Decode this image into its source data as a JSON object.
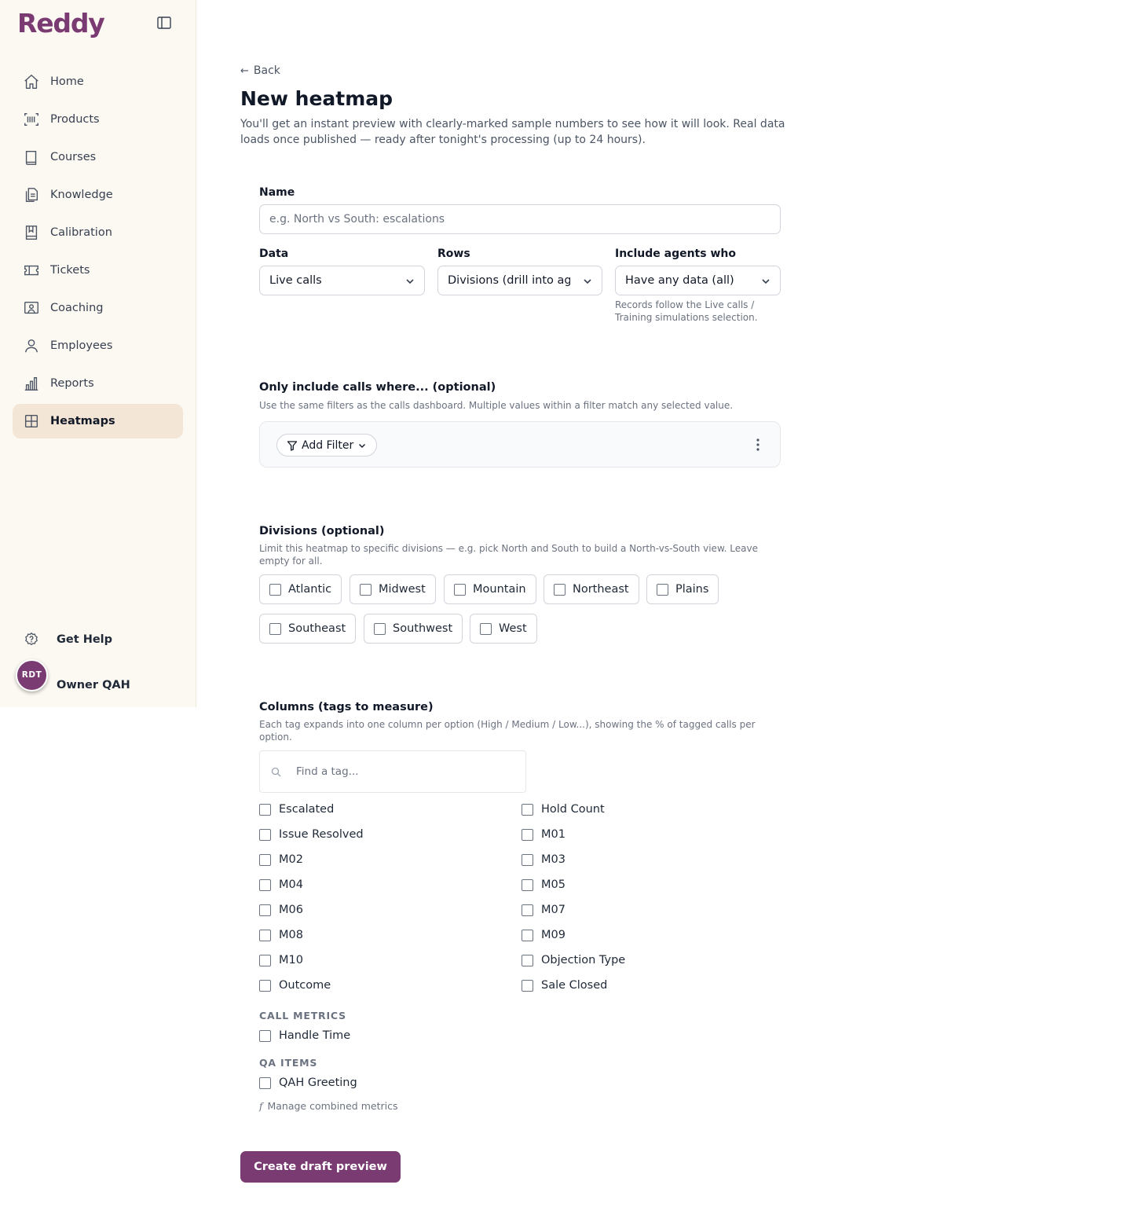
{
  "app": {
    "logo": "Reddy"
  },
  "sidebar": {
    "items": [
      {
        "label": "Home",
        "icon": "home-icon"
      },
      {
        "label": "Products",
        "icon": "barcode-icon"
      },
      {
        "label": "Courses",
        "icon": "book-icon"
      },
      {
        "label": "Knowledge",
        "icon": "documents-icon"
      },
      {
        "label": "Calibration",
        "icon": "bookmark-book-icon"
      },
      {
        "label": "Tickets",
        "icon": "ticket-icon"
      },
      {
        "label": "Coaching",
        "icon": "coaching-icon"
      },
      {
        "label": "Employees",
        "icon": "user-icon"
      },
      {
        "label": "Reports",
        "icon": "bar-chart-icon"
      },
      {
        "label": "Heatmaps",
        "icon": "grid-icon",
        "active": true
      }
    ],
    "help_label": "Get Help",
    "user": {
      "initials": "RDT",
      "name": "Owner QAH"
    }
  },
  "page": {
    "back_label": "Back",
    "title": "New heatmap",
    "subtitle": "You'll get an instant preview with clearly-marked sample numbers to see how it will look. Real data loads once published — ready after tonight's processing (up to 24 hours)."
  },
  "form": {
    "name_label": "Name",
    "name_placeholder": "e.g. North vs South: escalations",
    "name_value": "",
    "data_label": "Data",
    "data_value": "Live calls",
    "rows_label": "Rows",
    "rows_value": "Divisions (drill into agents)",
    "include_label": "Include agents who",
    "include_value": "Have any data (all)",
    "include_hint": "Records follow the Live calls / Training simulations selection."
  },
  "filters": {
    "title": "Only include calls where... (optional)",
    "description": "Use the same filters as the calls dashboard. Multiple values within a filter match any selected value.",
    "add_filter_label": "Add Filter"
  },
  "divisions": {
    "title": "Divisions (optional)",
    "description": "Limit this heatmap to specific divisions — e.g. pick North and South to build a North-vs-South view. Leave empty for all.",
    "options": [
      "Atlantic",
      "Midwest",
      "Mountain",
      "Northeast",
      "Plains",
      "Southeast",
      "Southwest",
      "West"
    ]
  },
  "columns": {
    "title": "Columns (tags to measure)",
    "description": "Each tag expands into one column per option (High / Medium / Low...), showing the % of tagged calls per option.",
    "search_placeholder": "Find a tag...",
    "tags": [
      "Escalated",
      "Hold Count",
      "Issue Resolved",
      "M01",
      "M02",
      "M03",
      "M04",
      "M05",
      "M06",
      "M07",
      "M08",
      "M09",
      "M10",
      "Objection Type",
      "Outcome",
      "Sale Closed"
    ],
    "call_metrics_heading": "CALL METRICS",
    "call_metrics": [
      "Handle Time"
    ],
    "qa_items_heading": "QA ITEMS",
    "qa_items": [
      "QAH Greeting"
    ],
    "manage_label": "Manage combined metrics"
  },
  "actions": {
    "create_label": "Create draft preview"
  },
  "colors": {
    "brand": "#7a3a72",
    "sidebar_bg": "#fcf8f2",
    "active_bg": "#f4e6d6"
  }
}
